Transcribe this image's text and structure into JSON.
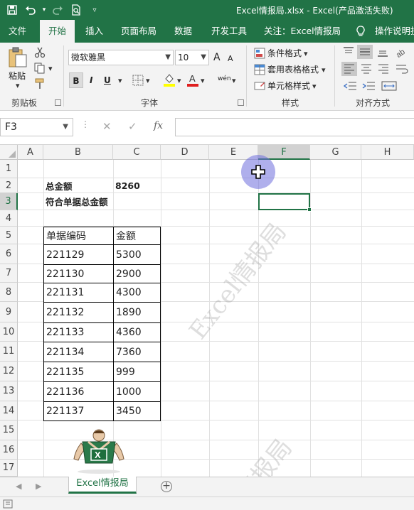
{
  "titlebar": {
    "title": "Excel情报局.xlsx  -  Excel(产品激活失败)",
    "qat": [
      "save-icon",
      "undo-icon",
      "redo-icon",
      "print-preview-icon",
      "customize-icon"
    ]
  },
  "tabs": [
    {
      "label": "文件"
    },
    {
      "label": "开始"
    },
    {
      "label": "插入"
    },
    {
      "label": "页面布局"
    },
    {
      "label": "数据"
    },
    {
      "label": "开发工具"
    },
    {
      "label": "关注：Excel情报局"
    },
    {
      "label": "操作说明搜"
    }
  ],
  "ribbon": {
    "clipboard": {
      "paste": "粘贴",
      "group": "剪贴板"
    },
    "font": {
      "name": "微软雅黑",
      "size": "10",
      "bold": "B",
      "italic": "I",
      "underline": "U",
      "grow": "A",
      "shrink": "A",
      "wen": "wén",
      "group": "字体"
    },
    "styles": {
      "conditional": "条件格式",
      "table": "套用表格格式",
      "cell": "单元格样式",
      "group": "样式"
    },
    "alignment": {
      "group": "对齐方式"
    }
  },
  "formula_bar": {
    "name_box": "F3",
    "fx": "fx",
    "value": ""
  },
  "columns": [
    "A",
    "B",
    "C",
    "D",
    "E",
    "F",
    "G",
    "H"
  ],
  "rows": [
    "1",
    "2",
    "3",
    "4",
    "5",
    "6",
    "7",
    "8",
    "9",
    "10",
    "11",
    "12",
    "13",
    "14",
    "15",
    "16",
    "17"
  ],
  "selected": {
    "column": "F",
    "row": "3"
  },
  "summary": {
    "total_label": "总金额",
    "total_value": "8260",
    "match_label": "符合单据总金额"
  },
  "table": {
    "headers": [
      "单据编码",
      "金额"
    ],
    "rows": [
      [
        "221129",
        "5300"
      ],
      [
        "221130",
        "2900"
      ],
      [
        "221131",
        "4300"
      ],
      [
        "221132",
        "1890"
      ],
      [
        "221133",
        "4360"
      ],
      [
        "221134",
        "7360"
      ],
      [
        "221135",
        "999"
      ],
      [
        "221136",
        "1000"
      ],
      [
        "221137",
        "3450"
      ]
    ]
  },
  "watermarks": [
    "Excel情报局",
    "情报局"
  ],
  "sheet": {
    "tab": "Excel情报局",
    "add": "+"
  }
}
